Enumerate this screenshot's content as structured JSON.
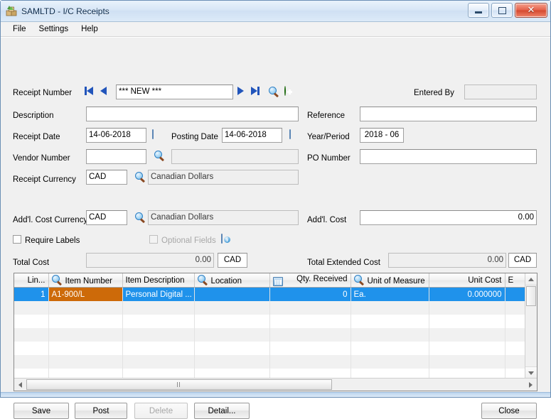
{
  "window": {
    "title": "SAMLTD - I/C Receipts",
    "app_icon": "boxes-icon",
    "minimize_label": "Minimize",
    "maximize_label": "Maximize",
    "close_label": "Close"
  },
  "menubar": {
    "items": [
      {
        "label": "File"
      },
      {
        "label": "Settings"
      },
      {
        "label": "Help"
      }
    ]
  },
  "form": {
    "receipt_number": {
      "label": "Receipt Number",
      "value": "*** NEW ***",
      "first_icon": "first-record-icon",
      "prev_icon": "previous-record-icon",
      "next_icon": "next-record-icon",
      "last_icon": "last-record-icon",
      "finder_icon": "magnifier-icon",
      "new_icon": "new-record-icon"
    },
    "entered_by": {
      "label": "Entered By",
      "value": ""
    },
    "description": {
      "label": "Description",
      "value": ""
    },
    "reference": {
      "label": "Reference",
      "value": ""
    },
    "receipt_date": {
      "label": "Receipt Date",
      "value": "14-06-2018",
      "calendar_icon": "calendar-icon"
    },
    "posting_date": {
      "label": "Posting Date",
      "value": "14-06-2018",
      "calendar_icon": "calendar-icon"
    },
    "year_period": {
      "label": "Year/Period",
      "value": "2018 - 06"
    },
    "vendor_number": {
      "label": "Vendor Number",
      "value": "",
      "name_value": "",
      "finder_icon": "magnifier-icon"
    },
    "po_number": {
      "label": "PO Number",
      "value": ""
    },
    "receipt_currency": {
      "label": "Receipt Currency",
      "code": "CAD",
      "description": "Canadian Dollars",
      "finder_icon": "magnifier-icon"
    },
    "addl_cost_currency": {
      "label": "Add'l. Cost Currency",
      "code": "CAD",
      "description": "Canadian Dollars",
      "finder_icon": "magnifier-icon"
    },
    "addl_cost": {
      "label": "Add'l. Cost",
      "value": "0.00"
    },
    "require_labels": {
      "label": "Require Labels",
      "checked": false
    },
    "optional_fields": {
      "label": "Optional Fields",
      "checked": false,
      "icon": "optional-fields-icon"
    },
    "total_cost": {
      "label": "Total Cost",
      "value": "0.00",
      "currency": "CAD"
    },
    "total_extended_cost": {
      "label": "Total Extended Cost",
      "value": "0.00",
      "currency": "CAD"
    }
  },
  "grid": {
    "columns": [
      {
        "key": "line",
        "label": "Lin...",
        "align": "right",
        "icon": ""
      },
      {
        "key": "item_number",
        "label": "Item Number",
        "align": "left",
        "icon": "magnifier-icon"
      },
      {
        "key": "item_desc",
        "label": "Item Description",
        "align": "left",
        "icon": ""
      },
      {
        "key": "location",
        "label": "Location",
        "align": "left",
        "icon": "magnifier-icon"
      },
      {
        "key": "qty",
        "label": "Qty. Received",
        "align": "right",
        "icon": "drilldown-icon"
      },
      {
        "key": "uom",
        "label": "Unit of Measure",
        "align": "left",
        "icon": "magnifier-icon"
      },
      {
        "key": "unit_cost",
        "label": "Unit Cost",
        "align": "right",
        "icon": ""
      },
      {
        "key": "ext_cost",
        "label": "E",
        "align": "right",
        "icon": ""
      }
    ],
    "rows": [
      {
        "selected": true,
        "active_cell": "item_number",
        "line": "1",
        "item_number": "A1-900/L",
        "item_desc": "Personal  Digital ...",
        "location": "",
        "qty": "0",
        "uom": "Ea.",
        "unit_cost": "0.000000",
        "ext_cost": ""
      },
      {
        "selected": false,
        "line": "",
        "item_number": "",
        "item_desc": "",
        "location": "",
        "qty": "",
        "uom": "",
        "unit_cost": "",
        "ext_cost": ""
      },
      {
        "selected": false,
        "line": "",
        "item_number": "",
        "item_desc": "",
        "location": "",
        "qty": "",
        "uom": "",
        "unit_cost": "",
        "ext_cost": ""
      },
      {
        "selected": false,
        "line": "",
        "item_number": "",
        "item_desc": "",
        "location": "",
        "qty": "",
        "uom": "",
        "unit_cost": "",
        "ext_cost": ""
      },
      {
        "selected": false,
        "line": "",
        "item_number": "",
        "item_desc": "",
        "location": "",
        "qty": "",
        "uom": "",
        "unit_cost": "",
        "ext_cost": ""
      },
      {
        "selected": false,
        "line": "",
        "item_number": "",
        "item_desc": "",
        "location": "",
        "qty": "",
        "uom": "",
        "unit_cost": "",
        "ext_cost": ""
      },
      {
        "selected": false,
        "line": "",
        "item_number": "",
        "item_desc": "",
        "location": "",
        "qty": "",
        "uom": "",
        "unit_cost": "",
        "ext_cost": ""
      }
    ]
  },
  "buttons": {
    "save": {
      "label": "Save",
      "enabled": true
    },
    "post": {
      "label": "Post",
      "enabled": true
    },
    "delete": {
      "label": "Delete",
      "enabled": false
    },
    "detail": {
      "label": "Detail...",
      "enabled": true
    },
    "close": {
      "label": "Close",
      "enabled": true
    }
  },
  "colors": {
    "selection_blue": "#1f92eb",
    "active_cell_orange": "#cd6a09",
    "window_border": "#6b8fb5",
    "client_background": "#f0f0f0"
  }
}
